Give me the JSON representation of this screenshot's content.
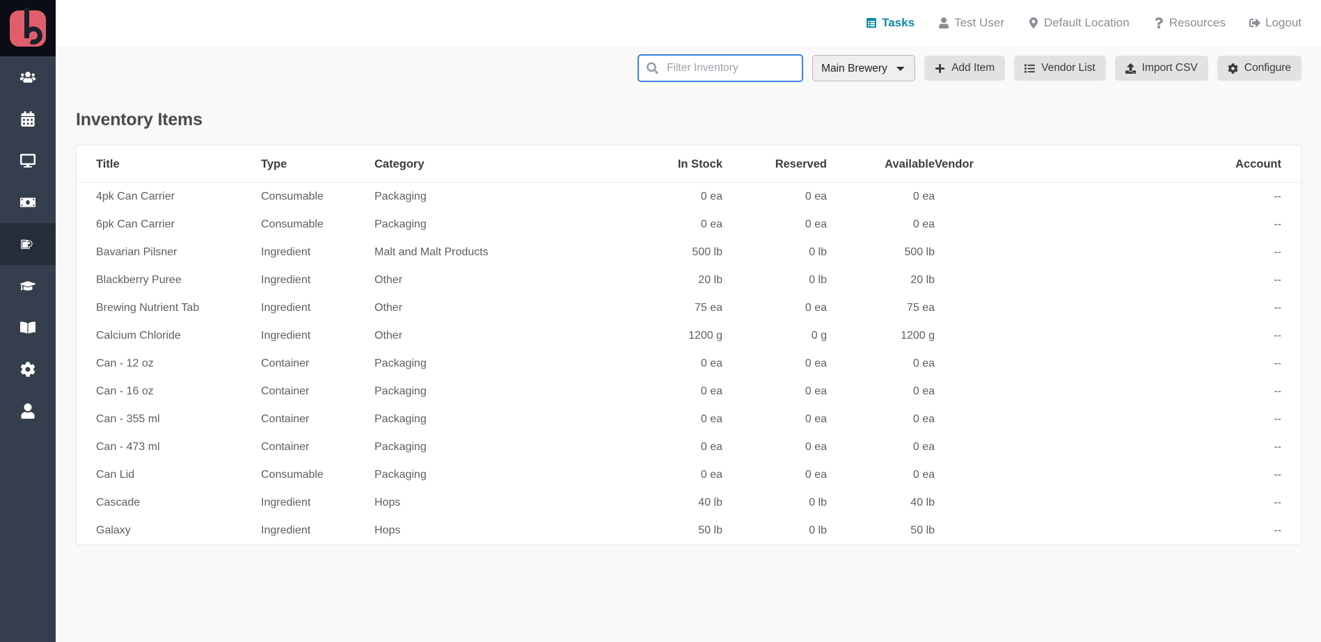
{
  "brand": {
    "logo_name": "brewery-logo",
    "accent_color": "#e05e6b",
    "sidebar_color": "#343e4c"
  },
  "sidebar": {
    "items": [
      {
        "icon": "users-icon",
        "label": "Users",
        "active": false
      },
      {
        "icon": "calendar-icon",
        "label": "Calendar",
        "active": false
      },
      {
        "icon": "desktop-icon",
        "label": "Desktop",
        "active": false
      },
      {
        "icon": "money-bill-icon",
        "label": "Billing",
        "active": false
      },
      {
        "icon": "beer-mug-icon",
        "label": "Inventory",
        "active": true
      },
      {
        "icon": "graduation-cap-icon",
        "label": "Training",
        "active": false
      },
      {
        "icon": "book-icon",
        "label": "Recipes",
        "active": false
      },
      {
        "icon": "gear-icon",
        "label": "Settings",
        "active": false
      },
      {
        "icon": "user-icon",
        "label": "Account",
        "active": false
      }
    ]
  },
  "topnav": {
    "items": [
      {
        "label": "Tasks",
        "icon": "tasks-icon",
        "active": true
      },
      {
        "label": "Test User",
        "icon": "user-icon",
        "active": false
      },
      {
        "label": "Default Location",
        "icon": "map-marker-icon",
        "active": false
      },
      {
        "label": "Resources",
        "icon": "question-icon",
        "active": false
      },
      {
        "label": "Logout",
        "icon": "sign-out-icon",
        "active": false
      }
    ],
    "active_color": "#0b8aa3"
  },
  "toolbar": {
    "search": {
      "placeholder": "Filter Inventory",
      "value": "",
      "icon": "search-icon",
      "focused": true,
      "focus_color": "#3b82e0"
    },
    "location_select": {
      "selected": "Main Brewery",
      "options": [
        "Main Brewery"
      ]
    },
    "buttons": [
      {
        "label": "Add Item",
        "icon": "plus-icon"
      },
      {
        "label": "Vendor List",
        "icon": "list-icon"
      },
      {
        "label": "Import CSV",
        "icon": "upload-icon"
      },
      {
        "label": "Configure",
        "icon": "gear-icon"
      }
    ]
  },
  "main": {
    "page_title": "Inventory Items",
    "table": {
      "columns": [
        "Title",
        "Type",
        "Category",
        "In Stock",
        "Reserved",
        "Available",
        "Vendor",
        "Account"
      ],
      "rows": [
        {
          "title": "4pk Can Carrier",
          "type": "Consumable",
          "category": "Packaging",
          "in_stock": "0 ea",
          "reserved": "0 ea",
          "available": "0 ea",
          "vendor": "",
          "account": "--"
        },
        {
          "title": "6pk Can Carrier",
          "type": "Consumable",
          "category": "Packaging",
          "in_stock": "0 ea",
          "reserved": "0 ea",
          "available": "0 ea",
          "vendor": "",
          "account": "--"
        },
        {
          "title": "Bavarian Pilsner",
          "type": "Ingredient",
          "category": "Malt and Malt Products",
          "in_stock": "500 lb",
          "reserved": "0 lb",
          "available": "500 lb",
          "vendor": "",
          "account": "--"
        },
        {
          "title": "Blackberry Puree",
          "type": "Ingredient",
          "category": "Other",
          "in_stock": "20 lb",
          "reserved": "0 lb",
          "available": "20 lb",
          "vendor": "",
          "account": "--"
        },
        {
          "title": "Brewing Nutrient Tab",
          "type": "Ingredient",
          "category": "Other",
          "in_stock": "75 ea",
          "reserved": "0 ea",
          "available": "75 ea",
          "vendor": "",
          "account": "--"
        },
        {
          "title": "Calcium Chloride",
          "type": "Ingredient",
          "category": "Other",
          "in_stock": "1200 g",
          "reserved": "0 g",
          "available": "1200 g",
          "vendor": "",
          "account": "--"
        },
        {
          "title": "Can - 12 oz",
          "type": "Container",
          "category": "Packaging",
          "in_stock": "0 ea",
          "reserved": "0 ea",
          "available": "0 ea",
          "vendor": "",
          "account": "--"
        },
        {
          "title": "Can - 16 oz",
          "type": "Container",
          "category": "Packaging",
          "in_stock": "0 ea",
          "reserved": "0 ea",
          "available": "0 ea",
          "vendor": "",
          "account": "--"
        },
        {
          "title": "Can - 355 ml",
          "type": "Container",
          "category": "Packaging",
          "in_stock": "0 ea",
          "reserved": "0 ea",
          "available": "0 ea",
          "vendor": "",
          "account": "--"
        },
        {
          "title": "Can - 473 ml",
          "type": "Container",
          "category": "Packaging",
          "in_stock": "0 ea",
          "reserved": "0 ea",
          "available": "0 ea",
          "vendor": "",
          "account": "--"
        },
        {
          "title": "Can Lid",
          "type": "Consumable",
          "category": "Packaging",
          "in_stock": "0 ea",
          "reserved": "0 ea",
          "available": "0 ea",
          "vendor": "",
          "account": "--"
        },
        {
          "title": "Cascade",
          "type": "Ingredient",
          "category": "Hops",
          "in_stock": "40 lb",
          "reserved": "0 lb",
          "available": "40 lb",
          "vendor": "",
          "account": "--"
        },
        {
          "title": "Galaxy",
          "type": "Ingredient",
          "category": "Hops",
          "in_stock": "50 lb",
          "reserved": "0 lb",
          "available": "50 lb",
          "vendor": "",
          "account": "--"
        }
      ]
    }
  }
}
